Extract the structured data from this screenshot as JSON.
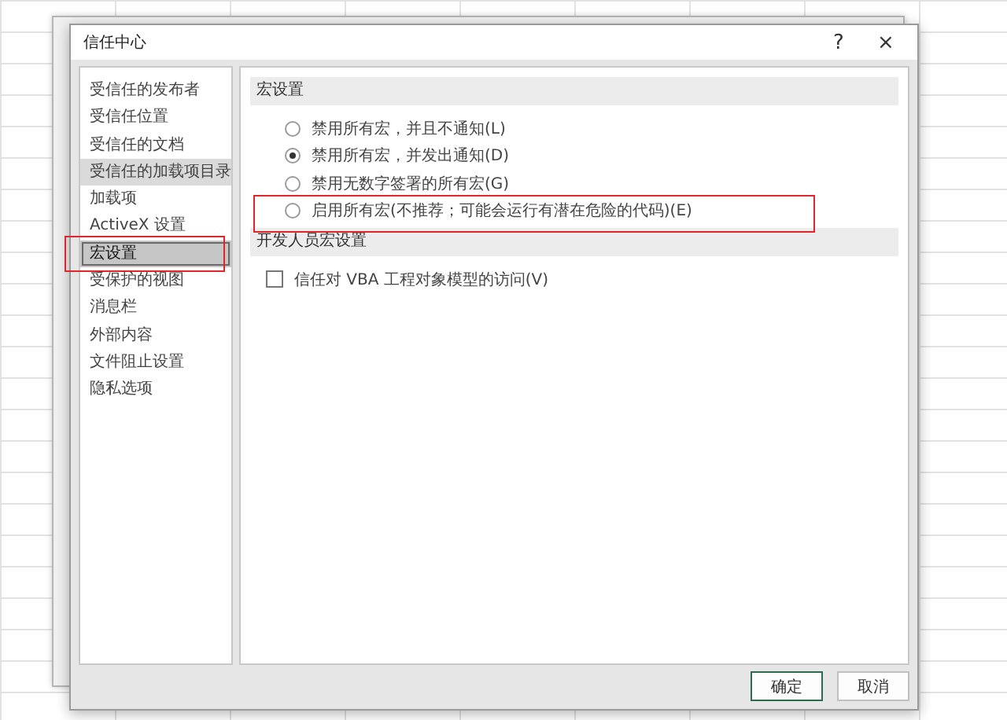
{
  "window": {
    "title": "信任中心",
    "help": "?",
    "close": "×"
  },
  "sidebar": {
    "items": [
      {
        "label": "受信任的发布者",
        "selected": false,
        "highlighted": false,
        "annotated": false
      },
      {
        "label": "受信任位置",
        "selected": false,
        "highlighted": false,
        "annotated": false
      },
      {
        "label": "受信任的文档",
        "selected": false,
        "highlighted": false,
        "annotated": false
      },
      {
        "label": "受信任的加载项目录",
        "selected": false,
        "highlighted": true,
        "annotated": false
      },
      {
        "label": "加载项",
        "selected": false,
        "highlighted": false,
        "annotated": false
      },
      {
        "label": "ActiveX 设置",
        "selected": false,
        "highlighted": false,
        "annotated": false
      },
      {
        "label": "宏设置",
        "selected": true,
        "highlighted": false,
        "annotated": true
      },
      {
        "label": "受保护的视图",
        "selected": false,
        "highlighted": false,
        "annotated": false
      },
      {
        "label": "消息栏",
        "selected": false,
        "highlighted": false,
        "annotated": false
      },
      {
        "label": "外部内容",
        "selected": false,
        "highlighted": false,
        "annotated": false
      },
      {
        "label": "文件阻止设置",
        "selected": false,
        "highlighted": false,
        "annotated": false
      },
      {
        "label": "隐私选项",
        "selected": false,
        "highlighted": false,
        "annotated": false
      }
    ]
  },
  "macro_settings": {
    "heading": "宏设置",
    "options": [
      {
        "label": "禁用所有宏，并且不通知(L)",
        "selected": false,
        "annotated": false
      },
      {
        "label": "禁用所有宏，并发出通知(D)",
        "selected": true,
        "annotated": false
      },
      {
        "label": "禁用无数字签署的所有宏(G)",
        "selected": false,
        "annotated": false
      },
      {
        "label": "启用所有宏(不推荐；可能会运行有潜在危险的代码)(E)",
        "selected": false,
        "annotated": true
      }
    ]
  },
  "developer_settings": {
    "heading": "开发人员宏设置",
    "checkbox": {
      "label": "信任对 VBA 工程对象模型的访问(V)",
      "checked": false
    }
  },
  "buttons": [
    {
      "label": "确定",
      "default": true
    },
    {
      "label": "取消",
      "default": false
    }
  ]
}
